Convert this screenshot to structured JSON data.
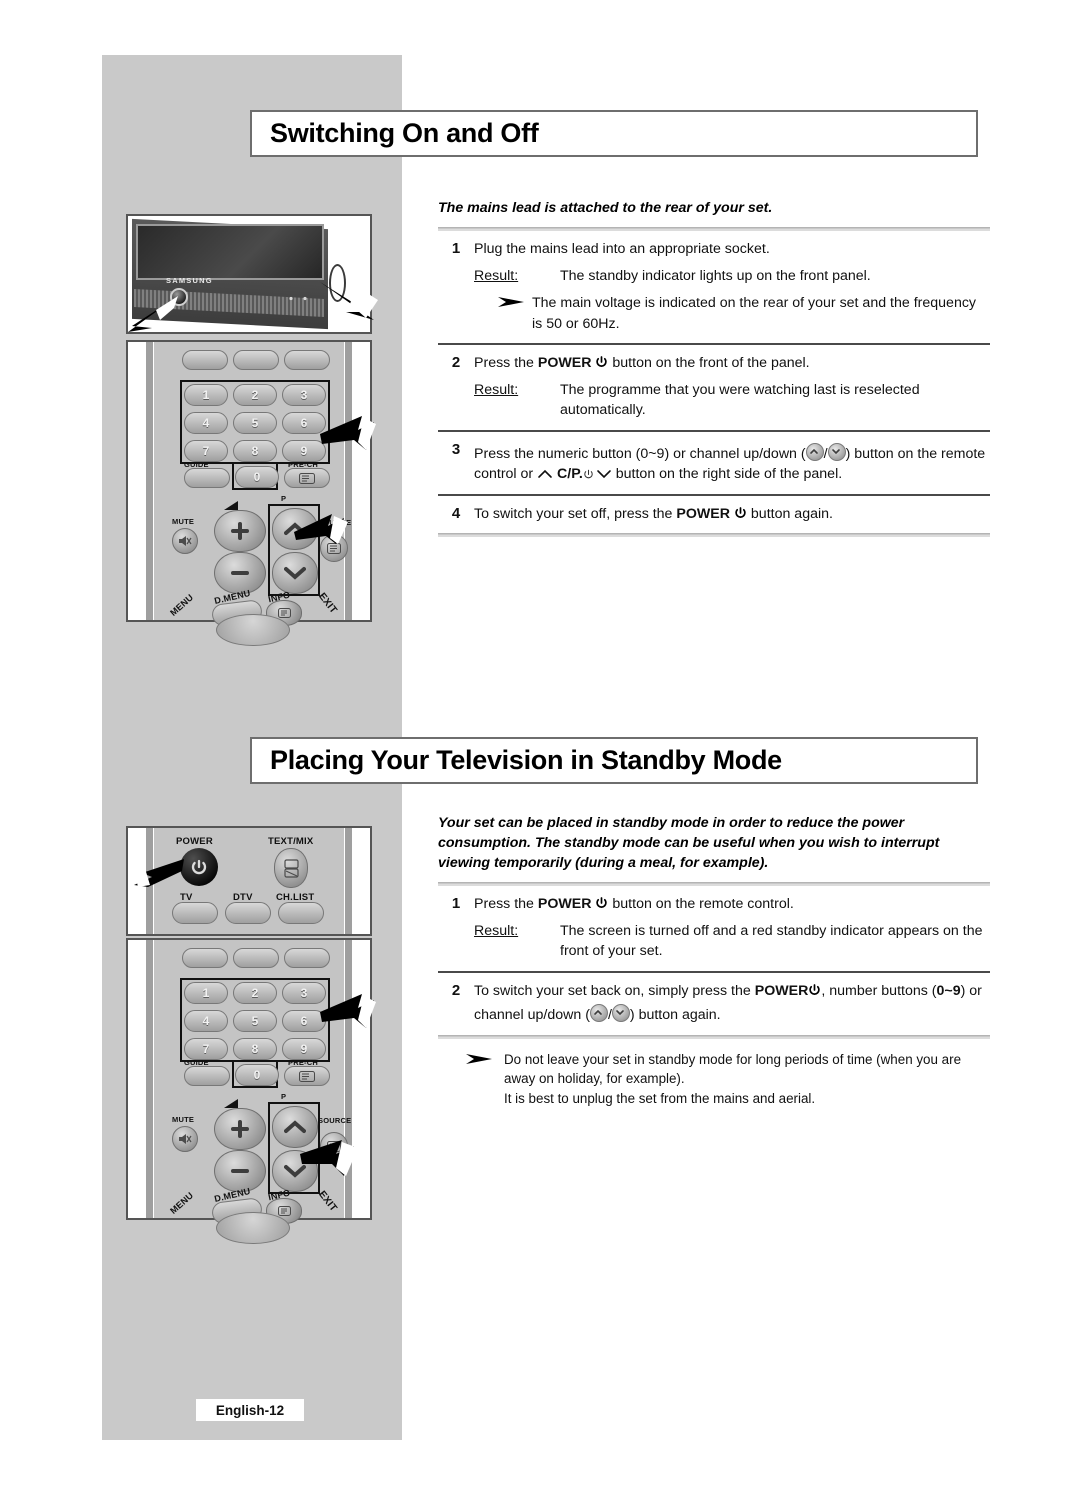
{
  "page": {
    "footer_label": "English-12",
    "colors": {
      "panel_grey": "#c9c9c9",
      "heading_border": "#6e6e6e",
      "rule_dark": "#4a4a4a"
    }
  },
  "sections": [
    {
      "id": "switching-on-and-off",
      "heading": "Switching On and Off",
      "intro": "The mains lead is attached to the rear of your set.",
      "steps": [
        {
          "number": "1",
          "text": "Plug the mains lead into an appropriate socket.",
          "result_label": "Result:",
          "result_text": "The standby indicator lights up on the front panel.",
          "note": "The main voltage is indicated on the rear of your set and the frequency is 50 or 60Hz."
        },
        {
          "number": "2",
          "text_before": "Press the",
          "text_bold": "POWER",
          "text_after": "button on the front of the panel.",
          "result_label": "Result:",
          "result_text": "The programme that you were watching last is reselected automatically."
        },
        {
          "number": "3",
          "line1_a": "Press the numeric button (0~9) or channel up/down (",
          "line1_b": "/",
          "line1_c": ") button",
          "line2_a": "on the remote control or",
          "line2_cp": "C/P.",
          "line2_b": "button on the right side of",
          "line3": "the panel."
        },
        {
          "number": "4",
          "text_before": "To switch your set off, press the",
          "text_bold": "POWER",
          "text_after": "button again."
        }
      ]
    },
    {
      "id": "placing-in-standby-mode",
      "heading": "Placing Your Television in Standby Mode",
      "intro": "Your set can be placed in standby mode in order to reduce the power consumption. The standby mode can be useful when you wish to interrupt viewing temporarily (during a meal, for example).",
      "steps": [
        {
          "number": "1",
          "text_before": "Press the",
          "text_bold": "POWER",
          "text_after": "button on the remote control.",
          "result_label": "Result:",
          "result_text": "The screen is turned off and a red standby indicator appears on the front of your set."
        },
        {
          "number": "2",
          "line1_a": "To switch your set back on, simply press the",
          "line1_bold": "POWER",
          "line1_b": ", number",
          "line2_a": "buttons (",
          "line2_bold": "0~9",
          "line2_b": ") or channel up/down (",
          "line2_c": "/",
          "line2_d": ") button  again."
        }
      ],
      "footnote_line1": "Do not leave your set in standby mode for long periods of time (when you are away on holiday, for example).",
      "footnote_line2": "It is best to unplug the set from the mains and aerial."
    }
  ],
  "illustrations": {
    "tv_front": {
      "name": "tv-front-panel",
      "brand": "SAMSUNG"
    },
    "remote_top": {
      "name": "remote-control-numeric",
      "numeric_keys": [
        "1",
        "2",
        "3",
        "4",
        "5",
        "6",
        "7",
        "8",
        "9",
        "0"
      ],
      "labels": {
        "guide": "GUIDE",
        "prech": "PRE-CH",
        "mute": "MUTE",
        "p": "P",
        "source": "SOURCE",
        "dmenu": "D.MENU",
        "info": "INFO",
        "menu": "MENU",
        "exit": "EXIT"
      }
    },
    "remote_power": {
      "name": "remote-control-power-row",
      "labels": {
        "power": "POWER",
        "textmix": "TEXT/MIX",
        "tv": "TV",
        "dtv": "DTV",
        "chlist": "CH.LIST"
      }
    },
    "remote_bottom": {
      "name": "remote-control-numeric-2",
      "numeric_keys": [
        "1",
        "2",
        "3",
        "4",
        "5",
        "6",
        "7",
        "8",
        "9",
        "0"
      ],
      "labels": {
        "guide": "GUIDE",
        "prech": "PRE-CH",
        "mute": "MUTE",
        "p": "P",
        "source": "SOURCE",
        "dmenu": "D.MENU",
        "info": "INFO",
        "menu": "MENU",
        "exit": "EXIT"
      }
    }
  }
}
